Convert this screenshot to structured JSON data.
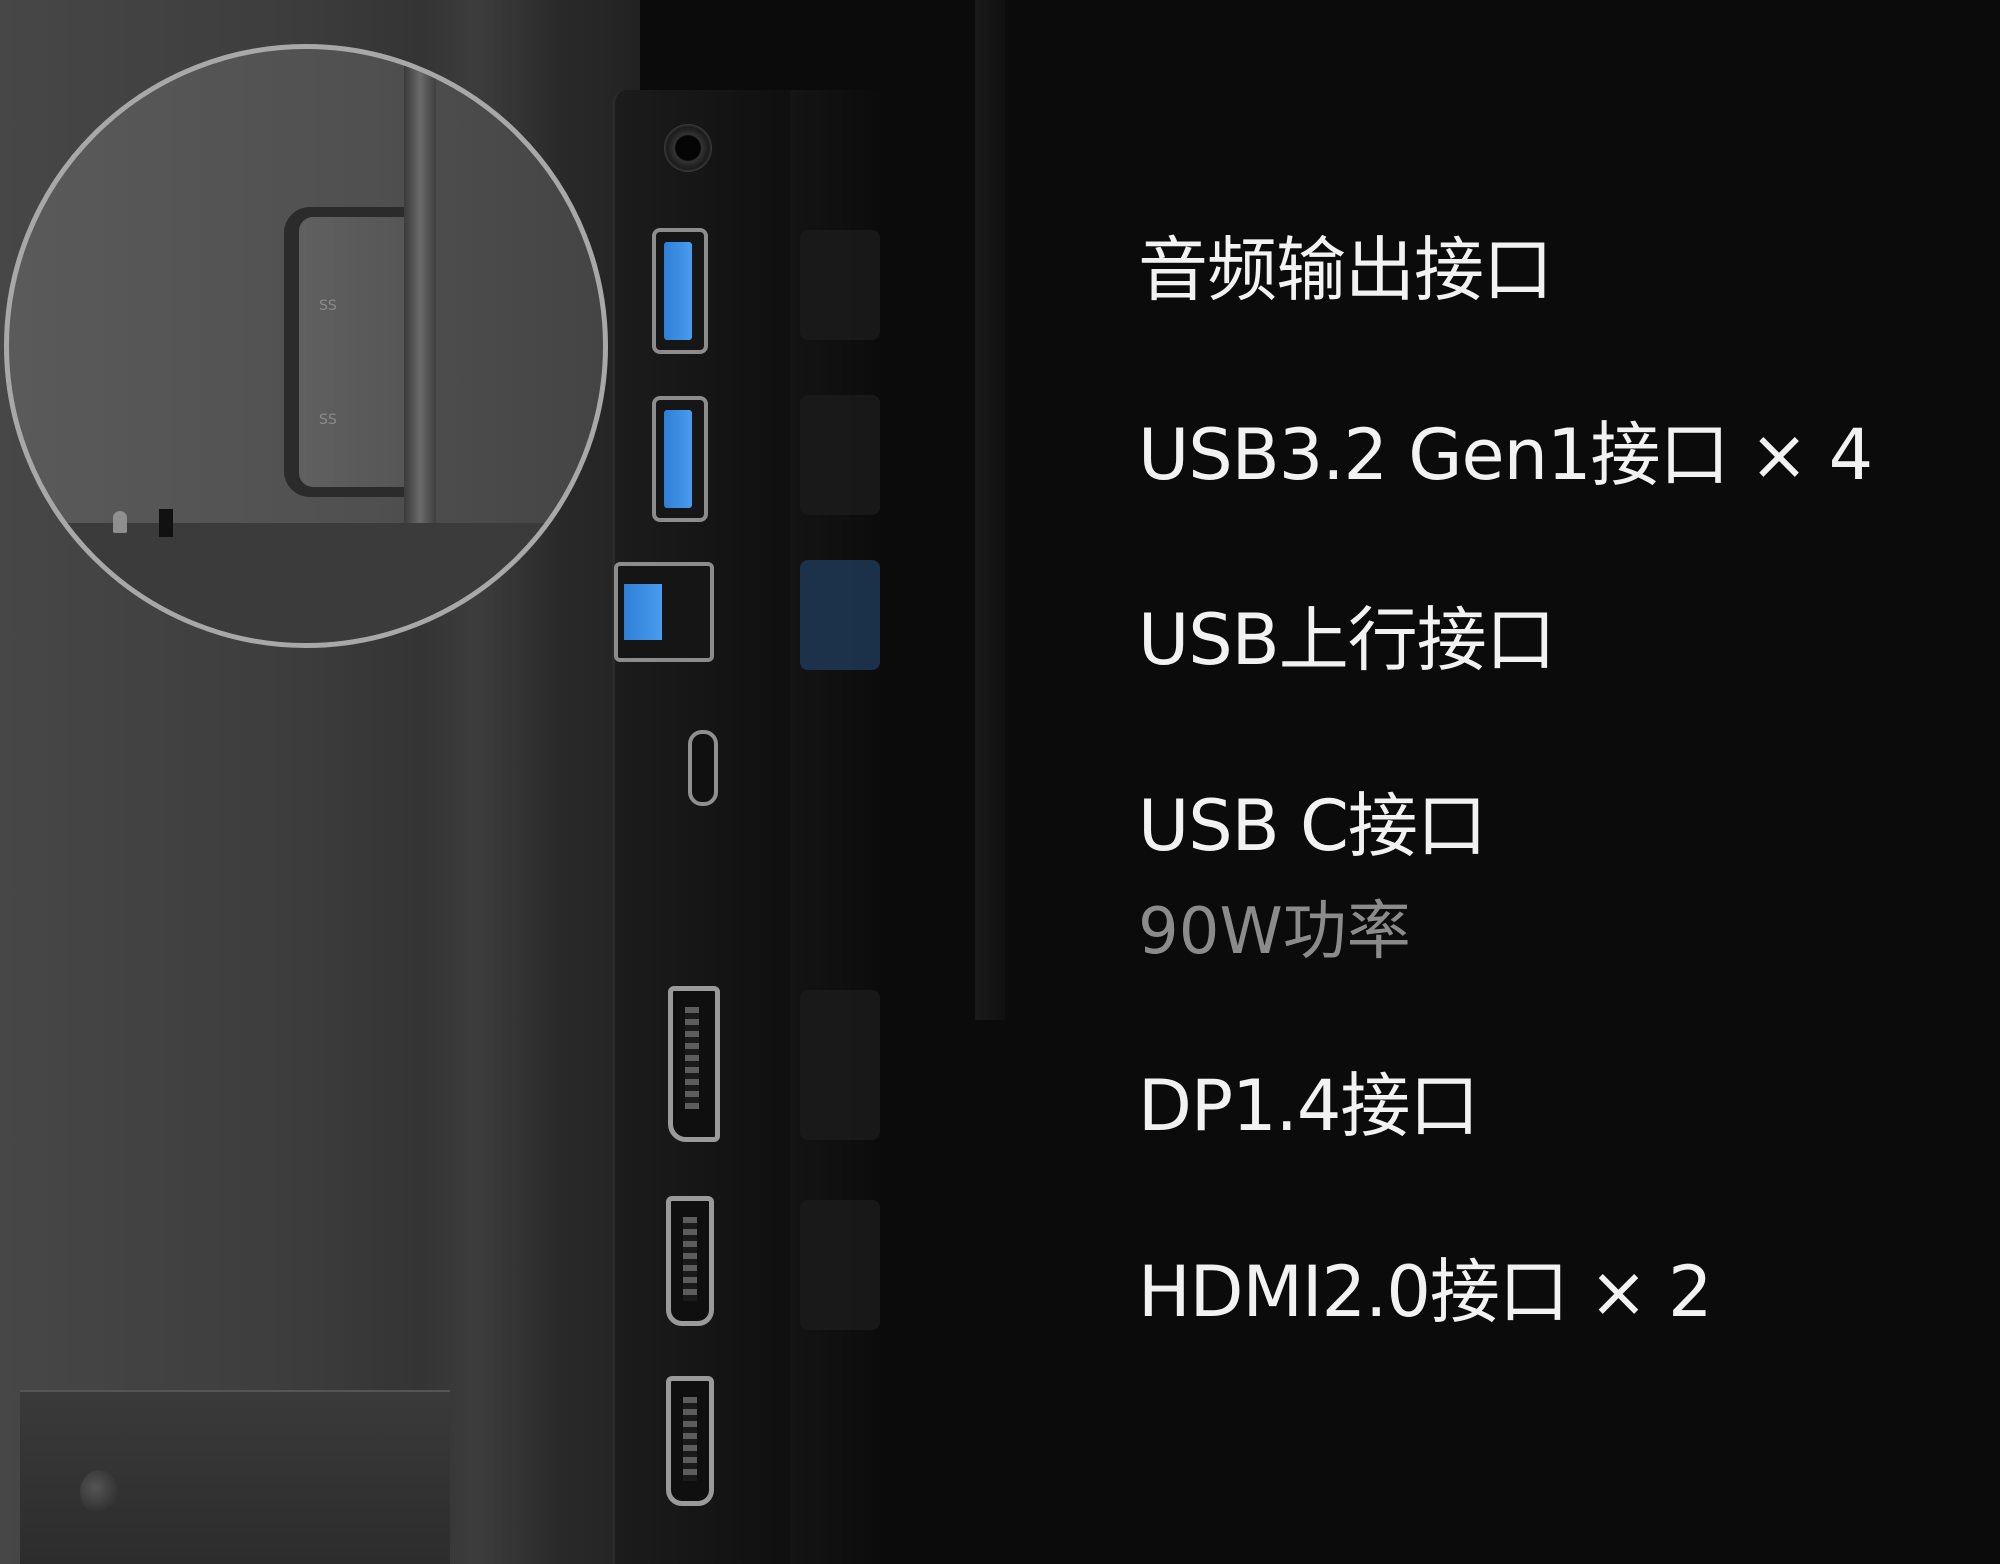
{
  "image": {
    "accent_color": "#3a8fe6",
    "background_color": "#0b0b0b",
    "zoom_inset": {
      "port_marks": [
        "SS",
        "SS"
      ],
      "icons": [
        "lock-icon",
        "kensington-slot-icon"
      ]
    },
    "ports_shown": [
      "audio-jack",
      "usb-a-port",
      "usb-a-port",
      "usb-b-upstream-port",
      "usb-c-port",
      "displayport",
      "hdmi-port",
      "hdmi-port"
    ]
  },
  "spec_list": [
    {
      "label": "音频输出接口"
    },
    {
      "label": "USB3.2 Gen1接口 × 4"
    },
    {
      "label": "USB上行接口"
    },
    {
      "label": "USB C接口",
      "sub": "90W功率"
    },
    {
      "label": "DP1.4接口"
    },
    {
      "label": "HDMI2.0接口 × 2"
    }
  ]
}
